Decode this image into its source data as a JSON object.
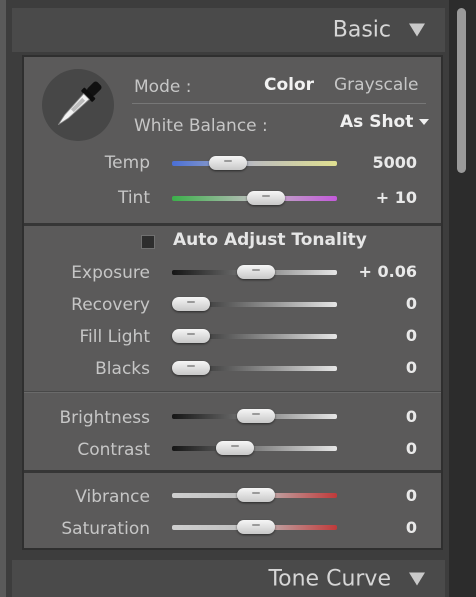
{
  "header": {
    "title": "Basic"
  },
  "mode": {
    "label": "Mode :",
    "options": [
      "Color",
      "Grayscale"
    ],
    "selected": "Color"
  },
  "white_balance": {
    "label": "White Balance :",
    "value": "As Shot"
  },
  "wb_sliders": [
    {
      "label": "Temp",
      "value": "5000",
      "position": 0.34,
      "colors": [
        "#4a6fd6",
        "#e0e090"
      ]
    },
    {
      "label": "Tint",
      "value": "+ 10",
      "position": 0.57,
      "colors": [
        "#3bb04a",
        "#c45adb"
      ]
    }
  ],
  "auto_adjust": {
    "label": "Auto Adjust Tonality",
    "checked": false
  },
  "tone_sliders": [
    {
      "label": "Exposure",
      "value": "+ 0.06",
      "position": 0.51
    },
    {
      "label": "Recovery",
      "value": "0",
      "position": 0.0
    },
    {
      "label": "Fill Light",
      "value": "0",
      "position": 0.0
    },
    {
      "label": "Blacks",
      "value": "0",
      "position": 0.0
    }
  ],
  "bc_sliders": [
    {
      "label": "Brightness",
      "value": "0",
      "position": 0.51
    },
    {
      "label": "Contrast",
      "value": "0",
      "position": 0.38
    }
  ],
  "presence_sliders": [
    {
      "label": "Vibrance",
      "value": "0",
      "position": 0.51,
      "colors": [
        "#cfcfcf",
        "#c03a3a"
      ]
    },
    {
      "label": "Saturation",
      "value": "0",
      "position": 0.51,
      "colors": [
        "#cfcfcf",
        "#c03a3a"
      ]
    }
  ],
  "footer": {
    "title": "Tone Curve"
  }
}
